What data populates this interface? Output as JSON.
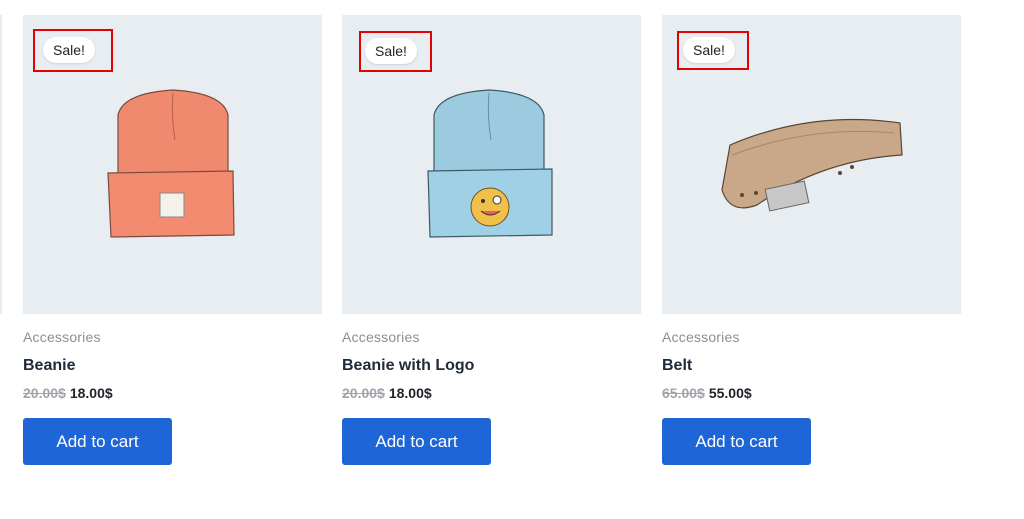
{
  "products": [
    {
      "badge": "Sale!",
      "category": "Accessories",
      "title": "Beanie",
      "old_price": "20.00$",
      "new_price": "18.00$",
      "button": "Add to cart"
    },
    {
      "badge": "Sale!",
      "category": "Accessories",
      "title": "Beanie with Logo",
      "old_price": "20.00$",
      "new_price": "18.00$",
      "button": "Add to cart"
    },
    {
      "badge": "Sale!",
      "category": "Accessories",
      "title": "Belt",
      "old_price": "65.00$",
      "new_price": "55.00$",
      "button": "Add to cart"
    }
  ],
  "colors": {
    "accent": "#1e66d8",
    "highlight": "#e60000",
    "image_bg": "#e8edf2"
  },
  "icons": [
    "orange-beanie-image",
    "blue-beanie-logo-image",
    "belt-image"
  ]
}
